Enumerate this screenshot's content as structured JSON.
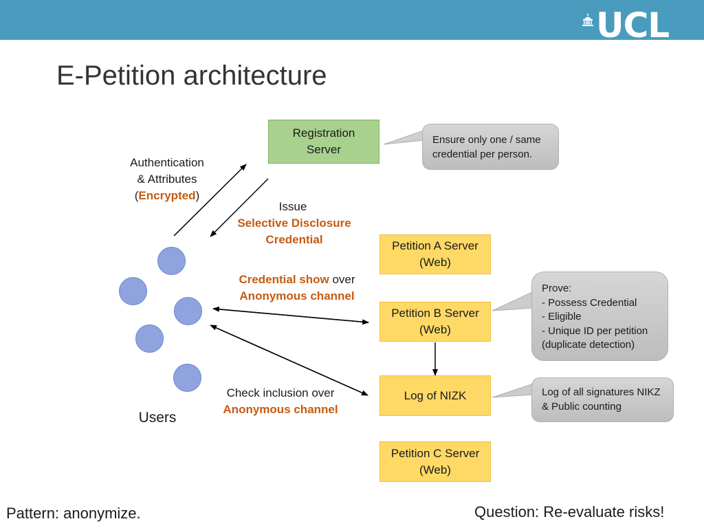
{
  "header": {
    "logo_text": "UCL",
    "logo_icon": "portico-dome-icon",
    "bar_color": "#4a9cbe"
  },
  "title": "E-Petition architecture",
  "servers": {
    "registration": {
      "line1": "Registration",
      "line2": "Server"
    },
    "petition_a": {
      "line1": "Petition A Server",
      "line2": "(Web)"
    },
    "petition_b": {
      "line1": "Petition B Server",
      "line2": "(Web)"
    },
    "log": {
      "line1": "Log of NIZK"
    },
    "petition_c": {
      "line1": "Petition C Server",
      "line2": "(Web)"
    }
  },
  "callouts": {
    "registration": {
      "line1": "Ensure only one / same",
      "line2": "credential per person."
    },
    "petition_b": {
      "line1": "Prove:",
      "line2": "- Possess Credential",
      "line3": "- Eligible",
      "line4": "- Unique ID per petition",
      "line5": "(duplicate detection)"
    },
    "log": {
      "line1": "Log of all signatures NIKZ",
      "line2": "& Public counting"
    }
  },
  "edge_labels": {
    "auth": {
      "line1": "Authentication",
      "line2": "& Attributes",
      "paren_open": "(",
      "highlight": "Encrypted",
      "paren_close": ")"
    },
    "issue": {
      "line1": "Issue",
      "highlight1": "Selective Disclosure",
      "highlight2": "Credential"
    },
    "show": {
      "highlight1": "Credential show",
      "plain": " over",
      "highlight2": "Anonymous channel"
    },
    "check": {
      "line1": "Check inclusion over",
      "highlight": "Anonymous channel"
    }
  },
  "users_label": "Users",
  "footer": {
    "left": "Pattern: anonymize.",
    "right": "Question: Re-evaluate risks!"
  },
  "colors": {
    "highlight": "#c55a11",
    "registration_fill": "#a9d18e",
    "petition_fill": "#ffd966",
    "user_fill": "#8fa3de",
    "callout_fill": "#c8c8c8"
  }
}
